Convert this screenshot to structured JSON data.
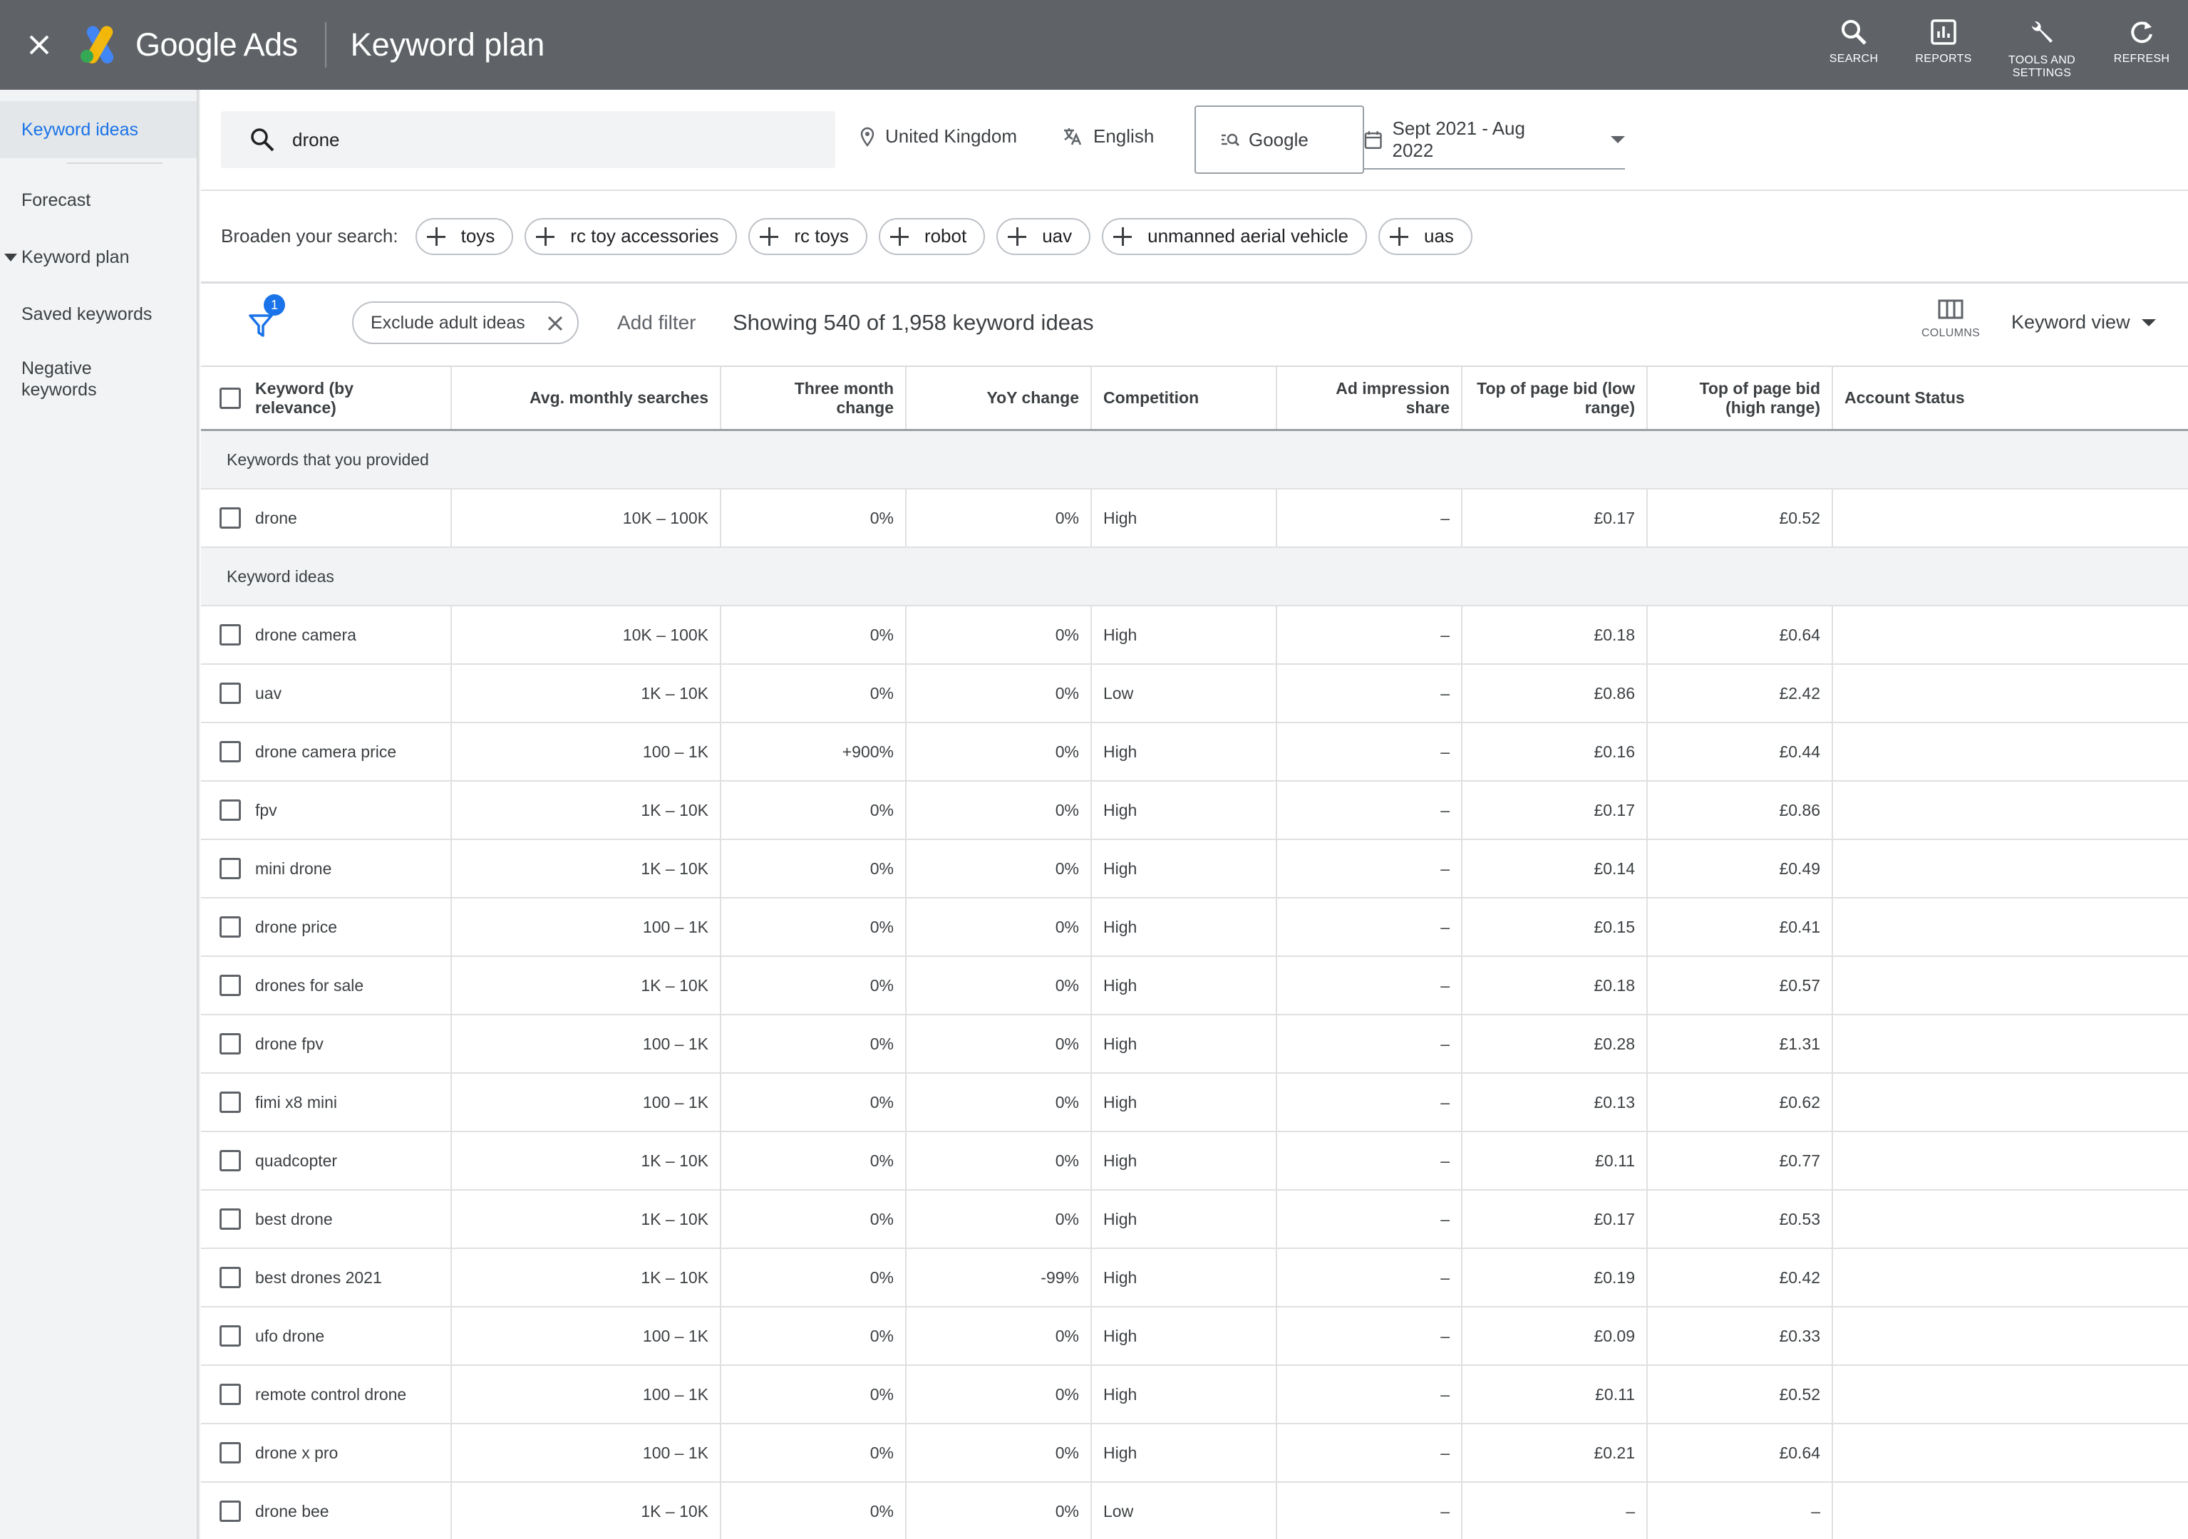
{
  "header": {
    "brand": "Google Ads",
    "page_title": "Keyword plan",
    "actions": [
      {
        "label": "SEARCH",
        "icon": "search-icon"
      },
      {
        "label": "REPORTS",
        "icon": "reports-icon"
      },
      {
        "label": "TOOLS AND SETTINGS",
        "icon": "wrench-icon"
      },
      {
        "label": "REFRESH",
        "icon": "refresh-icon"
      }
    ]
  },
  "sidebar": {
    "items": [
      {
        "label": "Keyword ideas"
      },
      {
        "label": "Forecast"
      },
      {
        "label": "Keyword plan"
      },
      {
        "label": "Saved keywords"
      },
      {
        "label": "Negative keywords"
      }
    ]
  },
  "search": {
    "query": "drone",
    "location": "United Kingdom",
    "language": "English",
    "network": "Google",
    "date_range": "Sept 2021 - Aug 2022"
  },
  "broaden": {
    "label": "Broaden your search:",
    "chips": [
      "toys",
      "rc toy accessories",
      "rc toys",
      "robot",
      "uav",
      "unmanned aerial vehicle",
      "uas"
    ]
  },
  "filters": {
    "badge_count": "1",
    "exclude_chip": "Exclude adult ideas",
    "add_filter": "Add filter",
    "showing": "Showing 540 of 1,958 keyword ideas",
    "columns_label": "COLUMNS",
    "view": "Keyword view"
  },
  "table": {
    "headers": {
      "keyword": "Keyword (by relevance)",
      "avg": "Avg. monthly searches",
      "three": "Three month change",
      "yoy": "YoY change",
      "comp": "Competition",
      "ad": "Ad impression share",
      "low": "Top of page bid (low range)",
      "high": "Top of page bid (high range)",
      "acct": "Account Status"
    },
    "group_provided": "Keywords that you provided",
    "provided": [
      {
        "kw": "drone",
        "avg": "10K – 100K",
        "three": "0%",
        "yoy": "0%",
        "comp": "High",
        "ad": "–",
        "low": "£0.17",
        "high": "£0.52"
      }
    ],
    "group_ideas": "Keyword ideas",
    "ideas": [
      {
        "kw": "drone camera",
        "avg": "10K – 100K",
        "three": "0%",
        "yoy": "0%",
        "comp": "High",
        "ad": "–",
        "low": "£0.18",
        "high": "£0.64"
      },
      {
        "kw": "uav",
        "avg": "1K – 10K",
        "three": "0%",
        "yoy": "0%",
        "comp": "Low",
        "ad": "–",
        "low": "£0.86",
        "high": "£2.42"
      },
      {
        "kw": "drone camera price",
        "avg": "100 – 1K",
        "three": "+900%",
        "yoy": "0%",
        "comp": "High",
        "ad": "–",
        "low": "£0.16",
        "high": "£0.44"
      },
      {
        "kw": "fpv",
        "avg": "1K – 10K",
        "three": "0%",
        "yoy": "0%",
        "comp": "High",
        "ad": "–",
        "low": "£0.17",
        "high": "£0.86"
      },
      {
        "kw": "mini drone",
        "avg": "1K – 10K",
        "three": "0%",
        "yoy": "0%",
        "comp": "High",
        "ad": "–",
        "low": "£0.14",
        "high": "£0.49"
      },
      {
        "kw": "drone price",
        "avg": "100 – 1K",
        "three": "0%",
        "yoy": "0%",
        "comp": "High",
        "ad": "–",
        "low": "£0.15",
        "high": "£0.41"
      },
      {
        "kw": "drones for sale",
        "avg": "1K – 10K",
        "three": "0%",
        "yoy": "0%",
        "comp": "High",
        "ad": "–",
        "low": "£0.18",
        "high": "£0.57"
      },
      {
        "kw": "drone fpv",
        "avg": "100 – 1K",
        "three": "0%",
        "yoy": "0%",
        "comp": "High",
        "ad": "–",
        "low": "£0.28",
        "high": "£1.31"
      },
      {
        "kw": "fimi x8 mini",
        "avg": "100 – 1K",
        "three": "0%",
        "yoy": "0%",
        "comp": "High",
        "ad": "–",
        "low": "£0.13",
        "high": "£0.62"
      },
      {
        "kw": "quadcopter",
        "avg": "1K – 10K",
        "three": "0%",
        "yoy": "0%",
        "comp": "High",
        "ad": "–",
        "low": "£0.11",
        "high": "£0.77"
      },
      {
        "kw": "best drone",
        "avg": "1K – 10K",
        "three": "0%",
        "yoy": "0%",
        "comp": "High",
        "ad": "–",
        "low": "£0.17",
        "high": "£0.53"
      },
      {
        "kw": "best drones 2021",
        "avg": "1K – 10K",
        "three": "0%",
        "yoy": "-99%",
        "comp": "High",
        "ad": "–",
        "low": "£0.19",
        "high": "£0.42"
      },
      {
        "kw": "ufo drone",
        "avg": "100 – 1K",
        "three": "0%",
        "yoy": "0%",
        "comp": "High",
        "ad": "–",
        "low": "£0.09",
        "high": "£0.33"
      },
      {
        "kw": "remote control drone",
        "avg": "100 – 1K",
        "three": "0%",
        "yoy": "0%",
        "comp": "High",
        "ad": "–",
        "low": "£0.11",
        "high": "£0.52"
      },
      {
        "kw": "drone x pro",
        "avg": "100 – 1K",
        "three": "0%",
        "yoy": "0%",
        "comp": "High",
        "ad": "–",
        "low": "£0.21",
        "high": "£0.64"
      },
      {
        "kw": "drone bee",
        "avg": "1K – 10K",
        "three": "0%",
        "yoy": "0%",
        "comp": "Low",
        "ad": "–",
        "low": "–",
        "high": "–"
      }
    ]
  }
}
